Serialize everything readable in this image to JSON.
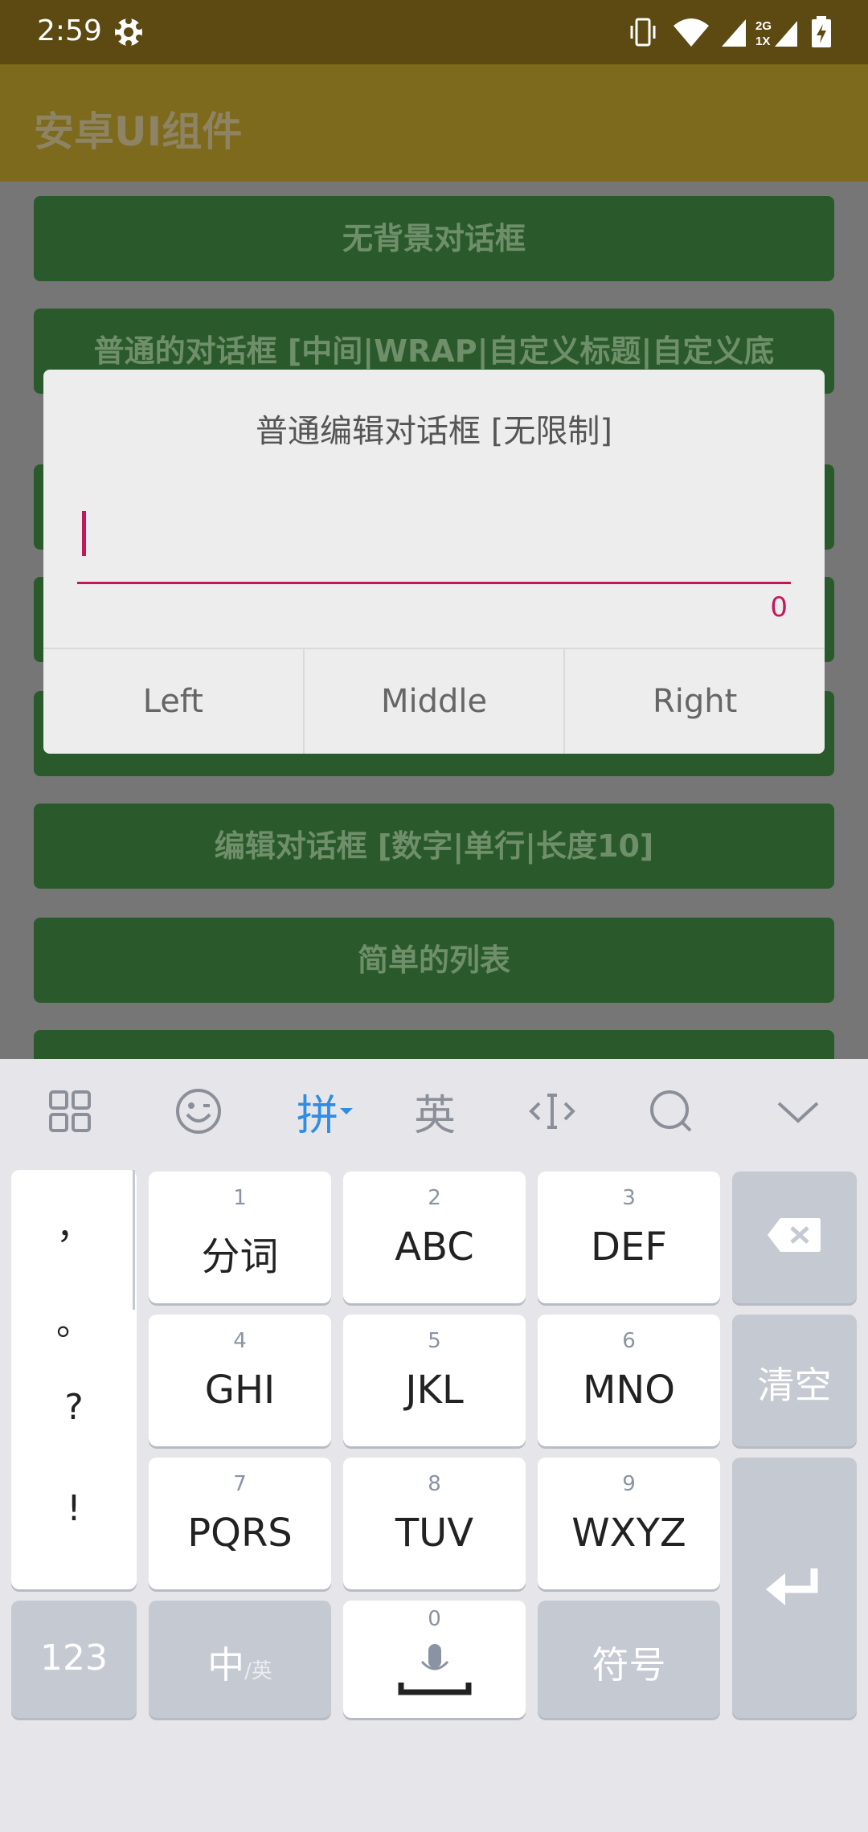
{
  "status_bar": {
    "time": "2:59",
    "network_label": "2G\n1X"
  },
  "app_bar": {
    "title": "安卓UI组件"
  },
  "list_buttons": [
    "无背景对话框",
    "普通的对话框 [中间|WRAP|自定义标题|自定义底",
    "",
    "",
    "",
    "编辑对话框 [数字|单行|长度10]",
    "简单的列表",
    ""
  ],
  "dialog": {
    "title": "普通编辑对话框 [无限制]",
    "input_value": "",
    "counter": "0",
    "buttons": {
      "left": "Left",
      "middle": "Middle",
      "right": "Right"
    }
  },
  "keyboard": {
    "toolbar": {
      "pinyin": "拼",
      "english": "英"
    },
    "punctuation": [
      "，",
      "。",
      "?",
      "!"
    ],
    "keys": [
      {
        "num": "1",
        "label": "分词"
      },
      {
        "num": "2",
        "label": "ABC"
      },
      {
        "num": "3",
        "label": "DEF"
      },
      {
        "num": "4",
        "label": "GHI"
      },
      {
        "num": "5",
        "label": "JKL"
      },
      {
        "num": "6",
        "label": "MNO"
      },
      {
        "num": "7",
        "label": "PQRS"
      },
      {
        "num": "8",
        "label": "TUV"
      },
      {
        "num": "9",
        "label": "WXYZ"
      }
    ],
    "clear_label": "清空",
    "numbers_label": "123",
    "lang_label": "中",
    "lang_sub": "/英",
    "space_num": "0",
    "symbol_label": "符号"
  },
  "colors": {
    "accent": "#c2185b",
    "keyboard_active": "#2f8de4",
    "button_green": "#2a5a2b"
  }
}
